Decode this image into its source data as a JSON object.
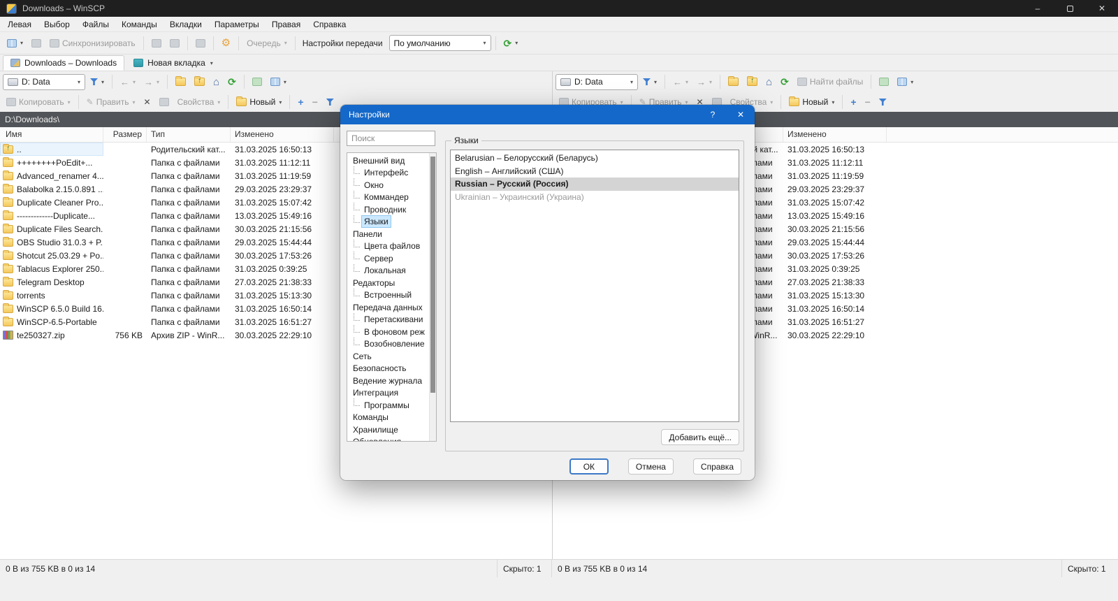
{
  "window": {
    "title": "Downloads – WinSCP",
    "controls": {
      "minimize": "–",
      "close": "✕"
    }
  },
  "menu": {
    "items": [
      {
        "label": "Левая",
        "name": "menu-left"
      },
      {
        "label": "Выбор",
        "name": "menu-mark"
      },
      {
        "label": "Файлы",
        "name": "menu-files"
      },
      {
        "label": "Команды",
        "name": "menu-commands"
      },
      {
        "label": "Вкладки",
        "name": "menu-tabs"
      },
      {
        "label": "Параметры",
        "name": "menu-options"
      },
      {
        "label": "Правая",
        "name": "menu-right"
      },
      {
        "label": "Справка",
        "name": "menu-help"
      }
    ]
  },
  "toolbar": {
    "synchronize": "Синхронизировать",
    "queue": "Очередь",
    "transfer_settings_label": "Настройки передачи",
    "transfer_preset": "По умолчанию"
  },
  "tabs": [
    {
      "label": "Downloads – Downloads"
    },
    {
      "label": "Новая вкладка"
    }
  ],
  "panel": {
    "drive": "D: Data",
    "copy": "Копировать",
    "edit": "Править",
    "properties": "Свойства",
    "new": "Новый",
    "find_files": "Найти файлы",
    "path": "D:\\Downloads\\"
  },
  "file_table": {
    "columns": [
      "Имя",
      "Размер",
      "Тип",
      "Изменено"
    ],
    "rows": [
      {
        "name": "..",
        "size": "",
        "type": "Родительский кат...",
        "modified": "31.03.2025 16:50:13",
        "icon": "folder-up"
      },
      {
        "name": "++++++++PoEdit+...",
        "size": "",
        "type": "Папка с файлами",
        "modified": "31.03.2025 11:12:11",
        "icon": "folder"
      },
      {
        "name": "Advanced_renamer 4...",
        "size": "",
        "type": "Папка с файлами",
        "modified": "31.03.2025 11:19:59",
        "icon": "folder"
      },
      {
        "name": "Balabolka 2.15.0.891 ...",
        "size": "",
        "type": "Папка с файлами",
        "modified": "29.03.2025 23:29:37",
        "icon": "folder"
      },
      {
        "name": "Duplicate Cleaner Pro...",
        "size": "",
        "type": "Папка с файлами",
        "modified": "31.03.2025 15:07:42",
        "icon": "folder"
      },
      {
        "name": "-------------Duplicate...",
        "size": "",
        "type": "Папка с файлами",
        "modified": "13.03.2025 15:49:16",
        "icon": "folder"
      },
      {
        "name": "Duplicate Files Search...",
        "size": "",
        "type": "Папка с файлами",
        "modified": "30.03.2025 21:15:56",
        "icon": "folder"
      },
      {
        "name": "OBS Studio 31.0.3 + P...",
        "size": "",
        "type": "Папка с файлами",
        "modified": "29.03.2025 15:44:44",
        "icon": "folder"
      },
      {
        "name": "Shotcut 25.03.29 + Po...",
        "size": "",
        "type": "Папка с файлами",
        "modified": "30.03.2025 17:53:26",
        "icon": "folder"
      },
      {
        "name": "Tablacus Explorer 250...",
        "size": "",
        "type": "Папка с файлами",
        "modified": "31.03.2025 0:39:25",
        "icon": "folder"
      },
      {
        "name": "Telegram Desktop",
        "size": "",
        "type": "Папка с файлами",
        "modified": "27.03.2025 21:38:33",
        "icon": "folder"
      },
      {
        "name": "torrents",
        "size": "",
        "type": "Папка с файлами",
        "modified": "31.03.2025 15:13:30",
        "icon": "folder"
      },
      {
        "name": "WinSCP 6.5.0 Build 16...",
        "size": "",
        "type": "Папка с файлами",
        "modified": "31.03.2025 16:50:14",
        "icon": "folder"
      },
      {
        "name": "WinSCP-6.5-Portable",
        "size": "",
        "type": "Папка с файлами",
        "modified": "31.03.2025 16:51:27",
        "icon": "folder"
      },
      {
        "name": "te250327.zip",
        "size": "756 KB",
        "type": "Архив ZIP - WinR...",
        "modified": "30.03.2025 22:29:10",
        "icon": "zip"
      }
    ]
  },
  "status": {
    "left_summary": "0 B из 755 KB в 0 из 14",
    "left_hidden": "Скрыто: 1",
    "right_summary": "0 B из 755 KB в 0 из 14",
    "right_hidden": "Скрыто: 1"
  },
  "dialog": {
    "title": "Настройки",
    "help_glyph": "?",
    "close_glyph": "✕",
    "search_placeholder": "Поиск",
    "tree": [
      {
        "label": "Внешний вид",
        "level": 0,
        "name": "appearance"
      },
      {
        "label": "Интерфейс",
        "level": 1,
        "name": "interface"
      },
      {
        "label": "Окно",
        "level": 1,
        "name": "window"
      },
      {
        "label": "Коммандер",
        "level": 1,
        "name": "commander"
      },
      {
        "label": "Проводник",
        "level": 1,
        "name": "explorer"
      },
      {
        "label": "Языки",
        "level": 1,
        "name": "languages",
        "selected": true
      },
      {
        "label": "Панели",
        "level": 0,
        "name": "panels"
      },
      {
        "label": "Цвета файлов",
        "level": 1,
        "name": "file-colors"
      },
      {
        "label": "Сервер",
        "level": 1,
        "name": "remote"
      },
      {
        "label": "Локальная",
        "level": 1,
        "name": "local"
      },
      {
        "label": "Редакторы",
        "level": 0,
        "name": "editors"
      },
      {
        "label": "Встроенный",
        "level": 1,
        "name": "internal-editor"
      },
      {
        "label": "Передача данных",
        "level": 0,
        "name": "transfer"
      },
      {
        "label": "Перетаскивани",
        "level": 1,
        "name": "drag-drop"
      },
      {
        "label": "В фоновом реж",
        "level": 1,
        "name": "background"
      },
      {
        "label": "Возобновление",
        "level": 1,
        "name": "resume"
      },
      {
        "label": "Сеть",
        "level": 0,
        "name": "network"
      },
      {
        "label": "Безопасность",
        "level": 0,
        "name": "security"
      },
      {
        "label": "Ведение журнала",
        "level": 0,
        "name": "logging"
      },
      {
        "label": "Интеграция",
        "level": 0,
        "name": "integration"
      },
      {
        "label": "Программы",
        "level": 1,
        "name": "applications"
      },
      {
        "label": "Команды",
        "level": 0,
        "name": "commands"
      },
      {
        "label": "Хранилище",
        "level": 0,
        "name": "storage"
      },
      {
        "label": "Обновления",
        "level": 0,
        "name": "updates"
      }
    ],
    "group_title": "Языки",
    "languages": [
      {
        "label": "Belarusian – Белорусский (Беларусь)",
        "state": "normal",
        "name": "language-belarusian"
      },
      {
        "label": "English – Английский (США)",
        "state": "normal",
        "name": "language-english"
      },
      {
        "label": "Russian – Русский (Россия)",
        "state": "selected",
        "name": "language-russian"
      },
      {
        "label": "Ukrainian – Украинский (Украина)",
        "state": "disabled",
        "name": "language-ukrainian"
      }
    ],
    "add_more_button": "Добавить ещё...",
    "ok_button": "ОК",
    "cancel_button": "Отмена",
    "help_button_label": "Справка"
  },
  "colors": {
    "dialog_titlebar": "#1468c9",
    "path_bar": "#515458",
    "accent": "#3f7fd1",
    "tree_selection": "#cbe8ff",
    "list_selection": "#d4d4d4",
    "folder_yellow": "#f5c85c",
    "refresh_green": "#2e9e2e",
    "gear_orange": "#e8a33d"
  }
}
